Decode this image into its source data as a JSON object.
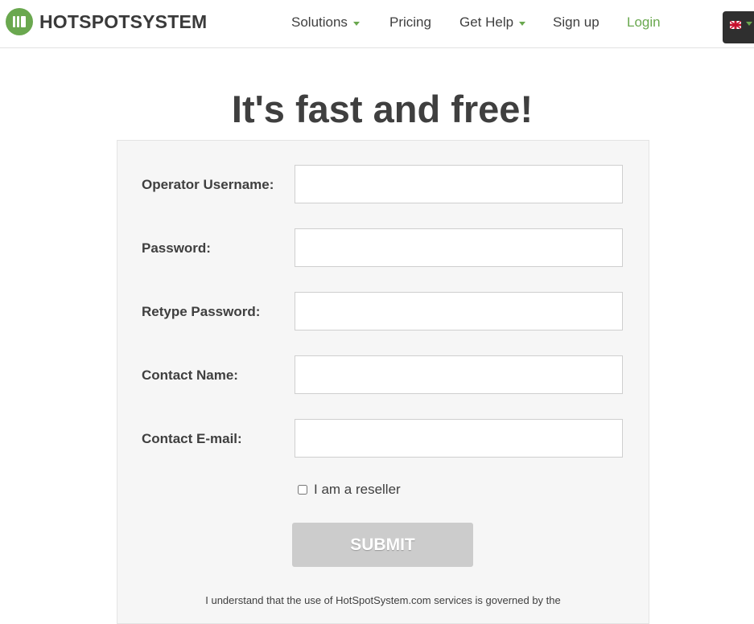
{
  "brand": {
    "name": "HOTSPOTSYSTEM",
    "accent_color": "#6aa84f"
  },
  "nav": {
    "items": [
      {
        "label": "Solutions",
        "has_dropdown": true
      },
      {
        "label": "Pricing",
        "has_dropdown": false
      },
      {
        "label": "Get Help",
        "has_dropdown": true
      },
      {
        "label": "Sign up",
        "has_dropdown": false
      },
      {
        "label": "Login",
        "has_dropdown": false
      }
    ],
    "language": {
      "icon": "uk-flag-icon",
      "selected": "English"
    }
  },
  "page": {
    "title": "It's fast and free!"
  },
  "form": {
    "fields": [
      {
        "label": "Operator Username:",
        "value": "",
        "type": "text"
      },
      {
        "label": "Password:",
        "value": "",
        "type": "password"
      },
      {
        "label": "Retype Password:",
        "value": "",
        "type": "password"
      },
      {
        "label": "Contact Name:",
        "value": "",
        "type": "text"
      },
      {
        "label": "Contact E-mail:",
        "value": "",
        "type": "email"
      }
    ],
    "reseller_checkbox": {
      "label": "I am a reseller",
      "checked": false
    },
    "submit_label": "SUBMIT",
    "terms_text": "I understand that the use of HotSpotSystem.com services is governed by the"
  }
}
